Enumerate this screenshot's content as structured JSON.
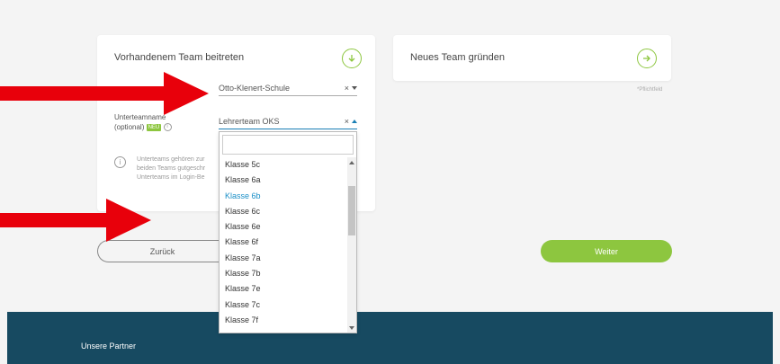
{
  "join_card": {
    "title": "Vorhandenem Team beitreten",
    "school_select": {
      "value": "Otto-Klenert-Schule",
      "clear": "×"
    },
    "subteam_label_line1": "Unterteamname",
    "subteam_label_line2": "(optional)",
    "new_badge": "NEU",
    "info_glyph": "i",
    "subteam_select": {
      "value": "Lehrerteam OKS",
      "clear": "×"
    },
    "info_text_line1": "Unterteams gehören zur",
    "info_text_line2": "beiden Teams gutgeschr",
    "info_text_line3": "Unterteams im Login-Be"
  },
  "new_card": {
    "title": "Neues Team gründen"
  },
  "required_note": "*Pflichtfeld",
  "dropdown": {
    "search_placeholder": "",
    "selected": "Klasse 6b",
    "items": [
      "Klasse 5c",
      "Klasse 6a",
      "Klasse 6b",
      "Klasse 6c",
      "Klasse 6e",
      "Klasse 6f",
      "Klasse 7a",
      "Klasse 7b",
      "Klasse 7e",
      "Klasse 7c",
      "Klasse 7f"
    ]
  },
  "buttons": {
    "back": "Zurück",
    "next": "Weiter"
  },
  "footer": {
    "title": "Unsere Partner"
  },
  "colors": {
    "accent": "#8dc63f",
    "focus": "#1a7fb5",
    "footer_bg": "#174a61",
    "arrow": "#e8000b"
  }
}
